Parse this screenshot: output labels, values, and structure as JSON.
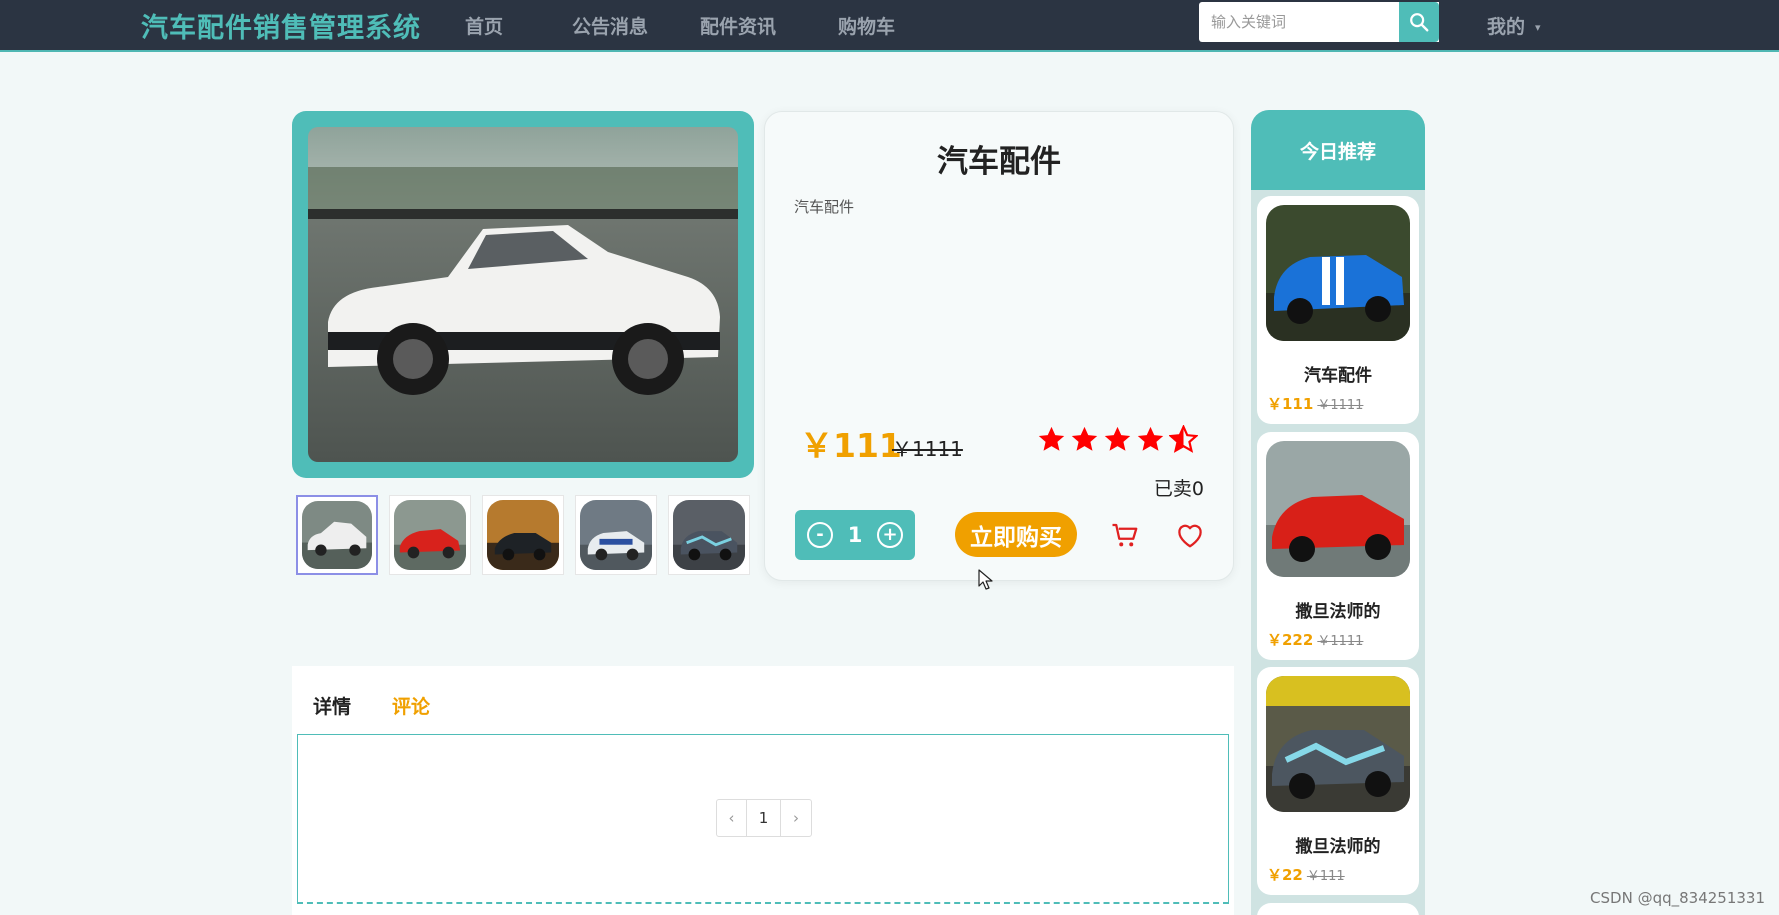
{
  "header": {
    "brand": "汽车配件销售管理系统",
    "nav": [
      {
        "label": "首页"
      },
      {
        "label": "公告消息"
      },
      {
        "label": "配件资讯"
      },
      {
        "label": "购物车"
      }
    ],
    "search_placeholder": "输入关键词",
    "user_menu": "我的"
  },
  "product": {
    "title": "汽车配件",
    "subtitle": "汽车配件",
    "price": "￥111",
    "old_price": "￥1111",
    "rating": 4.5,
    "sold": "已卖0",
    "quantity": "1",
    "qty_minus": "-",
    "qty_plus": "+",
    "buy_label": "立即购买",
    "thumbnails": [
      "thumb-white-coupe",
      "thumb-red-sports",
      "thumb-dark-car",
      "thumb-police-car",
      "thumb-livery-car"
    ]
  },
  "tabs": {
    "detail": "详情",
    "comment": "评论",
    "active": "comment"
  },
  "pager": {
    "prev": "‹",
    "current": "1",
    "next": "›"
  },
  "recommend": {
    "title": "今日推荐",
    "items": [
      {
        "name": "汽车配件",
        "price": "￥111",
        "old_price": "￥1111"
      },
      {
        "name": "撒旦法师的",
        "price": "￥222",
        "old_price": "￥1111"
      },
      {
        "name": "撒旦法师的",
        "price": "￥22",
        "old_price": "￥111"
      }
    ]
  },
  "watermark": "CSDN @qq_834251331",
  "colors": {
    "accent": "#4fbdb8",
    "price": "#f0a000",
    "star": "#ff0000",
    "nav_bg": "#2b3442"
  }
}
